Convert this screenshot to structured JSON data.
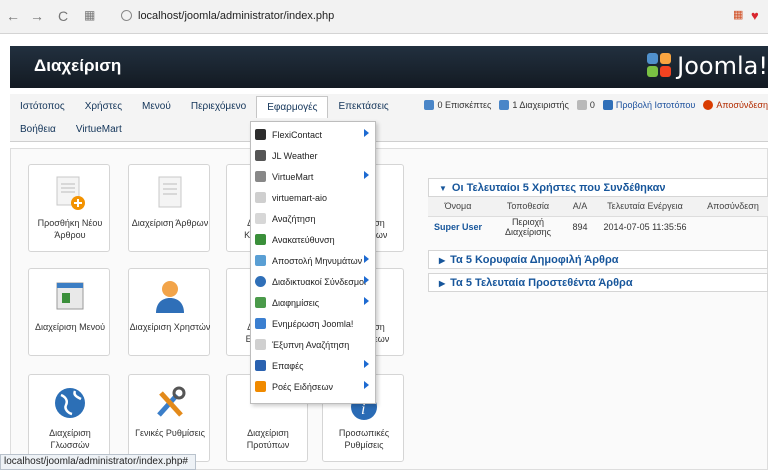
{
  "browser": {
    "url": "localhost/joomla/administrator/index.php",
    "back_icon": "back-arrow",
    "forward_icon": "forward-arrow",
    "reload_icon": "reload"
  },
  "header": {
    "title": "Διαχείριση",
    "logo_text": "Joomla!"
  },
  "menu": {
    "row1": [
      "Ιστότοπος",
      "Χρήστες",
      "Μενού",
      "Περιεχόμενο",
      "Εφαρμογές",
      "Επεκτάσεις"
    ],
    "row2": [
      "Βοήθεια",
      "VirtueMart"
    ],
    "active": "Εφαρμογές"
  },
  "status_links": {
    "visitors": "0 Επισκέπτες",
    "admins": "1 Διαχειριστής",
    "messages": "0",
    "view_site": "Προβολή Ιστοτόπου",
    "logout": "Αποσύνδεση"
  },
  "cpanel": {
    "tiles": [
      {
        "label": "Προσθήκη Νέου Άρθρου",
        "icon": "new-article-icon"
      },
      {
        "label": "Διαχείριση Άρθρων",
        "icon": "article-manager-icon"
      },
      {
        "label": "Διαχείριση Κατηγοριών",
        "icon": "category-manager-icon"
      },
      {
        "label": "Διαχείριση Πολυμέσων",
        "icon": "media-manager-icon"
      },
      {
        "label": "Διαχείριση Μενού",
        "icon": "menu-manager-icon"
      },
      {
        "label": "Διαχείριση Χρηστών",
        "icon": "user-manager-icon"
      },
      {
        "label": "Διαχείριση Ενθεμάτων",
        "icon": "module-manager-icon"
      },
      {
        "label": "Διαχείριση Επεκτάσεων",
        "icon": "extension-manager-icon"
      },
      {
        "label": "Διαχείριση Γλωσσών",
        "icon": "language-manager-icon"
      },
      {
        "label": "Γενικές Ρυθμίσεις",
        "icon": "global-config-icon"
      },
      {
        "label": "Διαχείριση Προτύπων",
        "icon": "template-manager-icon"
      },
      {
        "label": "Προσωπικές Ρυθμίσεις",
        "icon": "profile-icon"
      }
    ]
  },
  "dropdown": {
    "items": [
      {
        "label": "FlexiContact",
        "submenu": true,
        "color": "#2d2d2d"
      },
      {
        "label": "JL Weather",
        "submenu": false,
        "color": "#555555"
      },
      {
        "label": "VirtueMart",
        "submenu": true,
        "color": "#888888"
      },
      {
        "label": "virtuemart-aio",
        "submenu": false,
        "color": "#cfcfcf"
      },
      {
        "label": "Αναζήτηση",
        "submenu": false,
        "color": "#d7d7d7"
      },
      {
        "label": "Ανακατεύθυνση",
        "submenu": false,
        "color": "#3a8f3a"
      },
      {
        "label": "Αποστολή Μηνυμάτων",
        "submenu": true,
        "color": "#5a9fd4"
      },
      {
        "label": "Διαδικτυακοί Σύνδεσμοι",
        "submenu": true,
        "color": "#2f6fb8"
      },
      {
        "label": "Διαφημίσεις",
        "submenu": true,
        "color": "#4a9a4a"
      },
      {
        "label": "Ενημέρωση Joomla!",
        "submenu": false,
        "color": "#3b7fd0"
      },
      {
        "label": "Έξυπνη Αναζήτηση",
        "submenu": false,
        "color": "#d0d0d0"
      },
      {
        "label": "Επαφές",
        "submenu": true,
        "color": "#2a62b0"
      },
      {
        "label": "Ροές Ειδήσεων",
        "submenu": true,
        "color": "#f08a00"
      }
    ]
  },
  "panels": {
    "recent_users": {
      "title": "Οι Τελευταίοι 5 Χρήστες που Συνδέθηκαν",
      "columns": [
        "Όνομα",
        "Τοποθεσία",
        "Α/Α",
        "Τελευταία Ενέργεια",
        "Αποσύνδεση"
      ],
      "rows": [
        [
          "Super User",
          "Περιοχή Διαχείρισης",
          "894",
          "2014-07-05 11:35:56",
          ""
        ]
      ]
    },
    "popular": "Τα 5 Κορυφαία Δημοφιλή Άρθρα",
    "latest": "Τα 5 Τελευταία Προστεθέντα Άρθρα"
  },
  "statusbar": "localhost/joomla/administrator/index.php#"
}
